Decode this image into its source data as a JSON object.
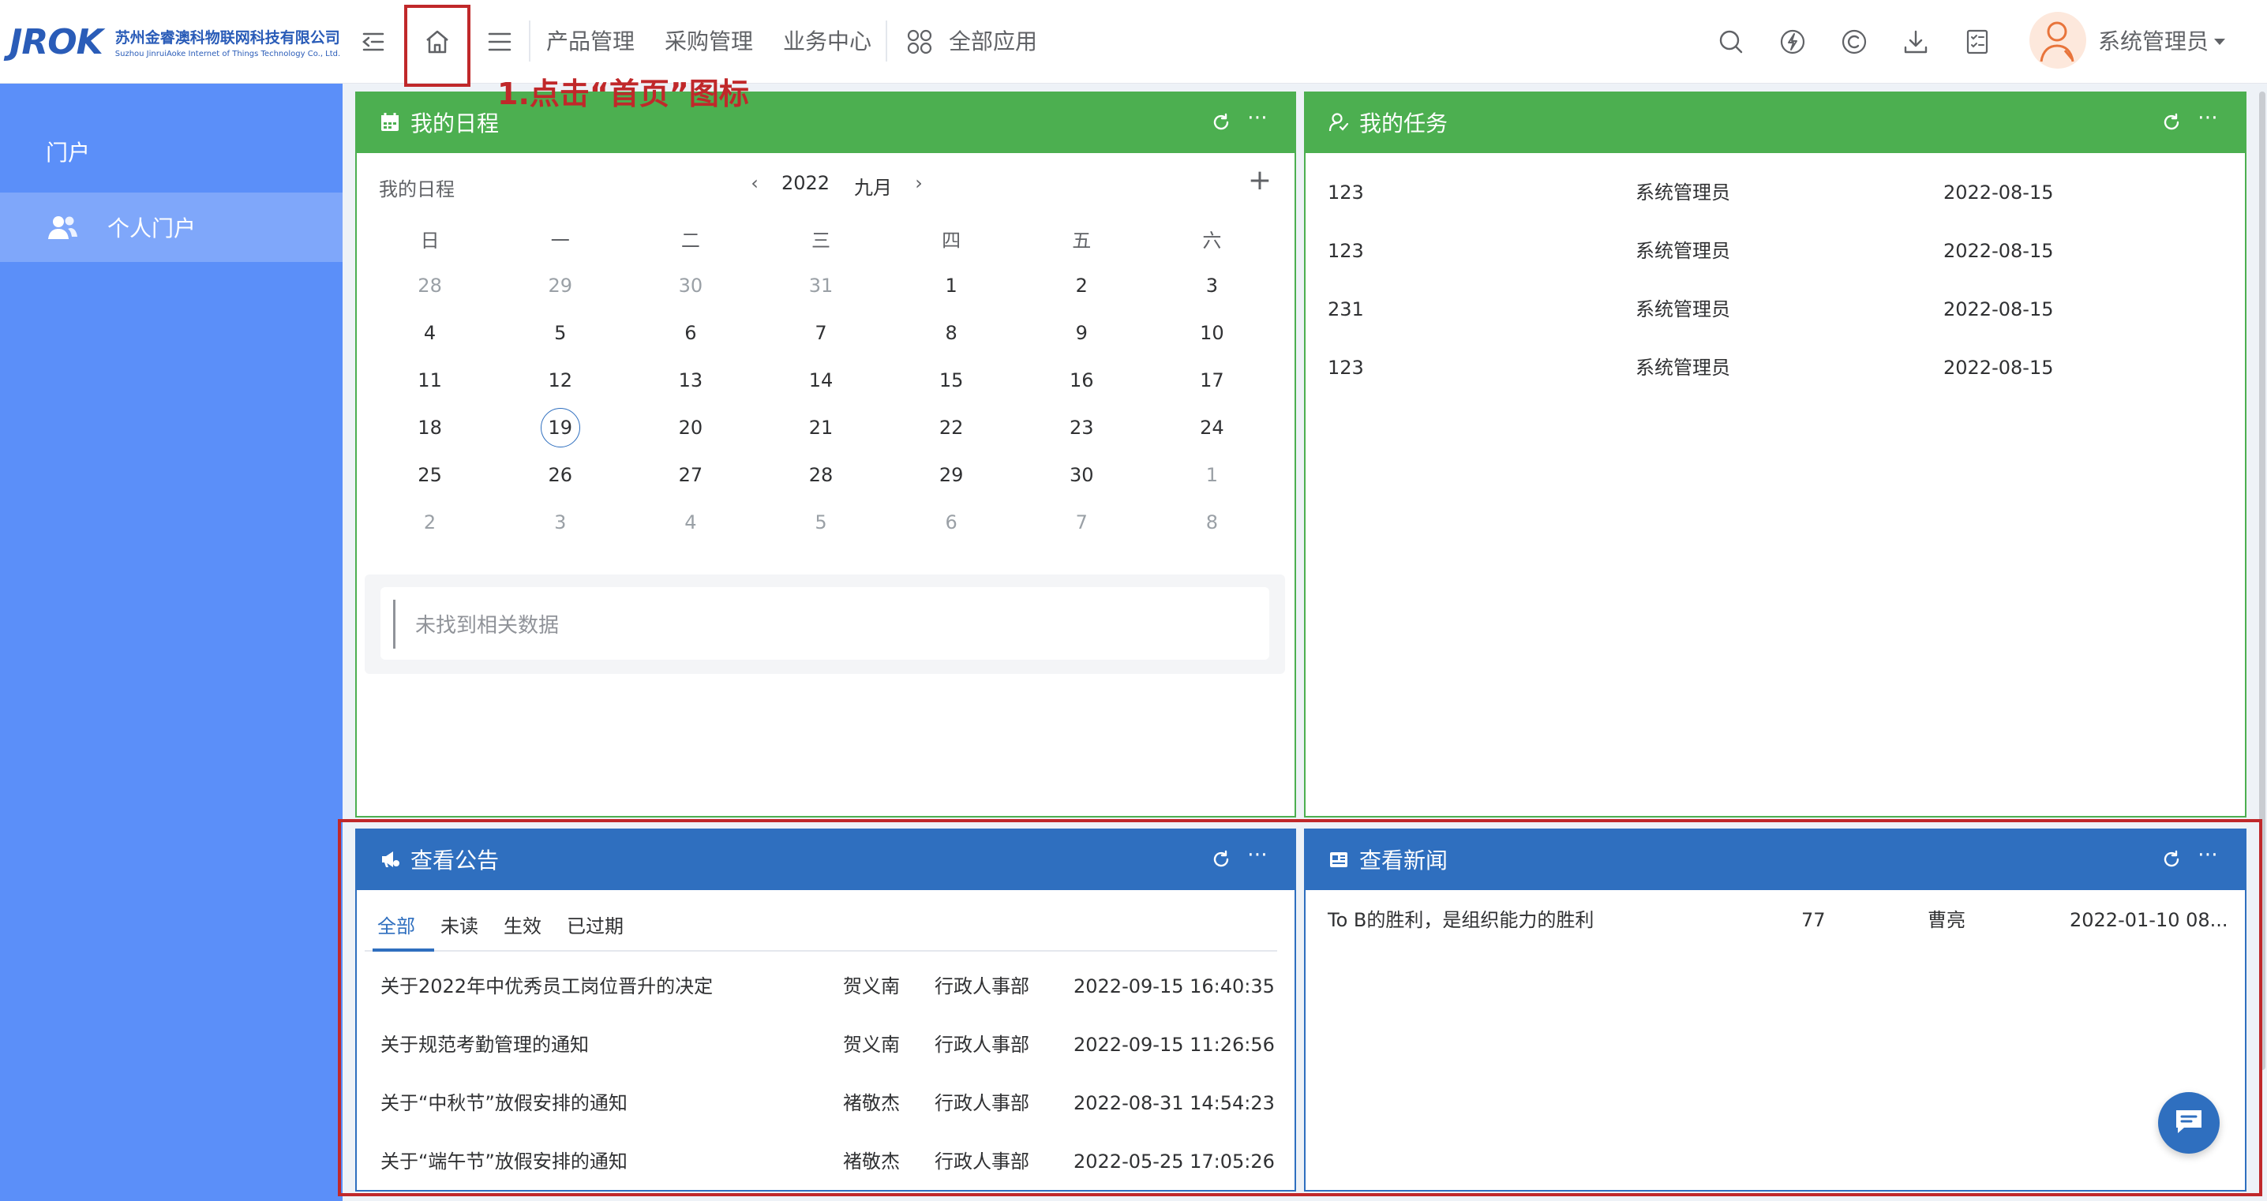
{
  "brand": {
    "logo": "JROK",
    "company_cn": "苏州金睿澳科物联网科技有限公司",
    "company_en": "Suzhou JinruiAoke Internet of Things Technology Co., Ltd."
  },
  "nav": {
    "items": [
      "产品管理",
      "采购管理",
      "业务中心"
    ],
    "all_apps": "全部应用"
  },
  "user": {
    "name": "系统管理员"
  },
  "sidebar": {
    "section": "门户",
    "items": [
      {
        "label": "个人门户"
      }
    ]
  },
  "annotation": {
    "text": "1.点击“首页”图标",
    "color": "#c0282a"
  },
  "schedule": {
    "title": "我的日程",
    "label": "我的日程",
    "year": "2022",
    "month": "九月",
    "weekdays": [
      "日",
      "一",
      "二",
      "三",
      "四",
      "五",
      "六"
    ],
    "weeks": [
      [
        "28",
        "29",
        "30",
        "31",
        "1",
        "2",
        "3"
      ],
      [
        "4",
        "5",
        "6",
        "7",
        "8",
        "9",
        "10"
      ],
      [
        "11",
        "12",
        "13",
        "14",
        "15",
        "16",
        "17"
      ],
      [
        "18",
        "19",
        "20",
        "21",
        "22",
        "23",
        "24"
      ],
      [
        "25",
        "26",
        "27",
        "28",
        "29",
        "30",
        "1"
      ],
      [
        "2",
        "3",
        "4",
        "5",
        "6",
        "7",
        "8"
      ]
    ],
    "today": "19",
    "empty": "未找到相关数据"
  },
  "tasks": {
    "title": "我的任务",
    "rows": [
      {
        "id": "123",
        "owner": "系统管理员",
        "date": "2022-08-15"
      },
      {
        "id": "123",
        "owner": "系统管理员",
        "date": "2022-08-15"
      },
      {
        "id": "231",
        "owner": "系统管理员",
        "date": "2022-08-15"
      },
      {
        "id": "123",
        "owner": "系统管理员",
        "date": "2022-08-15"
      }
    ]
  },
  "announcements": {
    "title": "查看公告",
    "tabs": [
      "全部",
      "未读",
      "生效",
      "已过期"
    ],
    "active_tab": "全部",
    "rows": [
      {
        "title": "关于2022年中优秀员工岗位晋升的决定",
        "author": "贺义南",
        "dept": "行政人事部",
        "time": "2022-09-15 16:40:35"
      },
      {
        "title": "关于规范考勤管理的通知",
        "author": "贺义南",
        "dept": "行政人事部",
        "time": "2022-09-15 11:26:56"
      },
      {
        "title": "关于“中秋节”放假安排的通知",
        "author": "褚敬杰",
        "dept": "行政人事部",
        "time": "2022-08-31 14:54:23"
      },
      {
        "title": "关于“端午节”放假安排的通知",
        "author": "褚敬杰",
        "dept": "行政人事部",
        "time": "2022-05-25 17:05:26"
      }
    ]
  },
  "news": {
    "title": "查看新闻",
    "rows": [
      {
        "title": "To B的胜利，是组织能力的胜利",
        "views": "77",
        "author": "曹亮",
        "time": "2022-01-10 08..."
      }
    ]
  },
  "colors": {
    "green": "#4caf50",
    "blue": "#2f6fbf",
    "sidebar": "#5b8ff9",
    "annotation": "#c0282a"
  }
}
